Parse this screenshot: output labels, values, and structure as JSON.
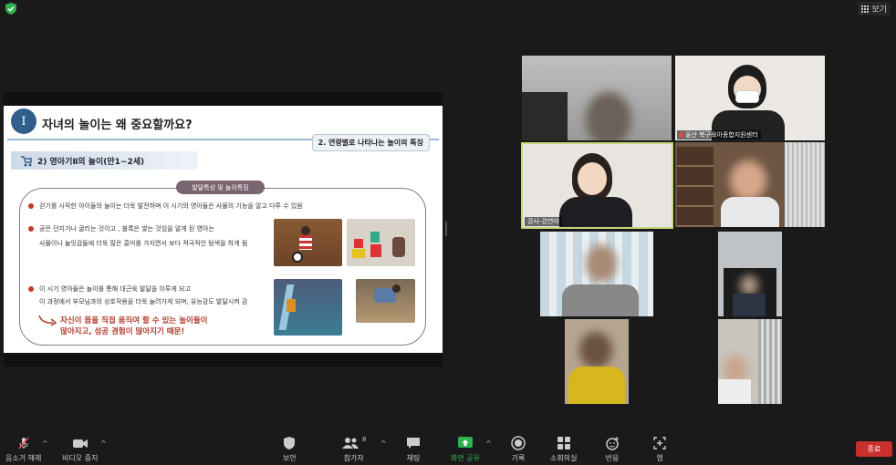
{
  "top_bar": {
    "view_label": "보기"
  },
  "slide": {
    "section_number": "I",
    "title": "자녀의 놀이는 왜 중요할까요?",
    "tag": "2. 연령별로 나타나는 놀이의 특징",
    "subtitle": "2) 영아기Ⅱ의 놀이(만1~2세)",
    "pill": "발달특성 및 놀이특징",
    "bullet1": "걷기를 시작한 아이들의 놀이는 더욱 발전하며 이 시기의 영아들은 사물의 기능을 알고 다루 수 있음",
    "bullet2_line1": "공은 던지거나 굴리는 것이고 , 블록은 쌓는 것임을 알게 된 영아는",
    "bullet2_line2": "사물이나 놀잇감들에 더욱 많은 흥미를 가지면서 보다 적극적인 탐색을 하게 됨",
    "bullet3_line1": "이 시기 영아들은 놀이를 통해 대근육 발달을 이루게 되고",
    "bullet3_line2": "이 과정에서 부모님과의 상호작용을 더욱 늘려가게 되며, 유능감도 발달시켜 감",
    "emphasis_line1": "자신이 몸을 직접 움직여 할 수 있는 놀이들이",
    "emphasis_line2": "많아지고, 성공 경험이 많아지기 때문!"
  },
  "gallery": {
    "names": [
      "울산 북구육아종합지원센터",
      "강사-강연아"
    ]
  },
  "toolbar": {
    "mute": "음소거 해제",
    "video": "비디오 중지",
    "security": "보안",
    "participants": "참가자",
    "participants_count": "8",
    "chat": "채팅",
    "share": "화면 공유",
    "record": "기록",
    "breakout": "소회의실",
    "reactions": "반응",
    "apps": "앱",
    "end": "종료"
  },
  "colors": {
    "share_green": "#2fb14d",
    "end_red": "#c9302c",
    "slide_blue": "#2f5f8a",
    "emphasis_red": "#b13a2c",
    "active_speaker": "#c7d87a"
  }
}
